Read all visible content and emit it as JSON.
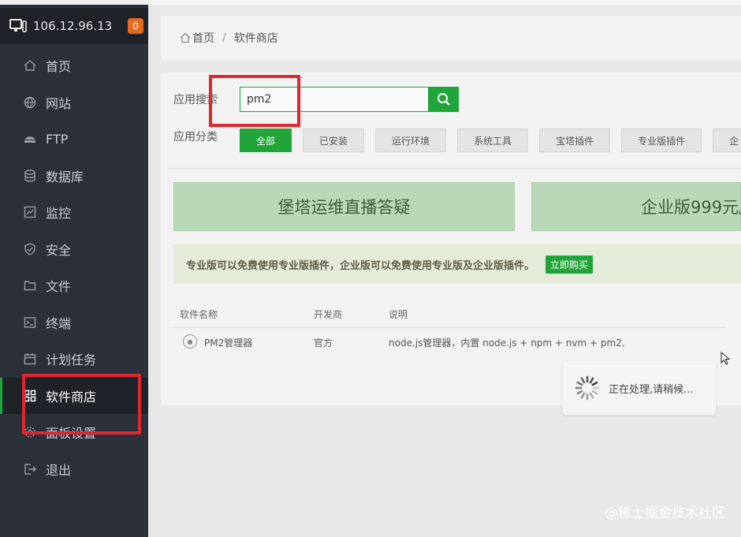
{
  "server": {
    "ip": "106.12.96.13",
    "badge": "0"
  },
  "sidebar": {
    "items": [
      {
        "label": "首页",
        "icon": "home-icon"
      },
      {
        "label": "网站",
        "icon": "globe-icon"
      },
      {
        "label": "FTP",
        "icon": "ftp-icon"
      },
      {
        "label": "数据库",
        "icon": "database-icon"
      },
      {
        "label": "监控",
        "icon": "monitor-icon"
      },
      {
        "label": "安全",
        "icon": "shield-icon"
      },
      {
        "label": "文件",
        "icon": "folder-icon"
      },
      {
        "label": "终端",
        "icon": "terminal-icon"
      },
      {
        "label": "计划任务",
        "icon": "calendar-icon"
      },
      {
        "label": "软件商店",
        "icon": "grid-icon"
      },
      {
        "label": "面板设置",
        "icon": "gear-icon"
      },
      {
        "label": "退出",
        "icon": "logout-icon"
      }
    ],
    "active_index": 9
  },
  "breadcrumb": {
    "home": "首页",
    "separator": "/",
    "current": "软件商店"
  },
  "search": {
    "label": "应用搜索",
    "value": "pm2"
  },
  "categories": {
    "label": "应用分类",
    "items": [
      "全部",
      "已安装",
      "运行环境",
      "系统工具",
      "宝塔插件",
      "专业版插件",
      "企"
    ],
    "active_index": 0
  },
  "banners": {
    "left": "堡塔运维直播答疑",
    "right": "企业版999元/"
  },
  "notice": {
    "text": "专业版可以免费使用专业版插件，企业版可以免费使用专业版及企业版插件。",
    "button": "立即购买"
  },
  "table": {
    "headers": {
      "name": "软件名称",
      "developer": "开发商",
      "description": "说明"
    },
    "rows": [
      {
        "name": "PM2管理器",
        "developer": "官方",
        "description": "node.js管理器，内置 node.js + npm + nvm + pm2."
      }
    ]
  },
  "loading": {
    "text": "正在处理,请稍候..."
  },
  "watermark": "@稀土掘金技术社区",
  "colors": {
    "accent": "#20a53a",
    "sidebar": "#2c3038",
    "highlight": "#e0262e",
    "badge": "#e56b1f"
  }
}
